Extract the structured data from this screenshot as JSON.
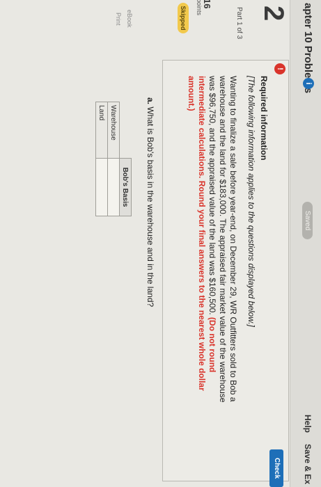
{
  "header": {
    "chapter_title": "apter 10 Problems",
    "info_icon_glyph": "i",
    "saved_label": "Saved",
    "help_label": "Help",
    "save_exit_label": "Save & Ex"
  },
  "sidebar": {
    "question_number": "2",
    "part_label": "Part 1 of 3",
    "points_value": "16",
    "points_label": "points",
    "status_badge": "Skipped",
    "ebook_label": "eBook",
    "print_label": "Print"
  },
  "required_info": {
    "alert_glyph": "!",
    "title": "Required information",
    "note": "[The following information applies to the questions displayed below.]",
    "body": "Wanting to finalize a sale before year-end, on December 29, WR Outfitters sold to Bob a warehouse and the land for $183,000. The appraised fair market value of the warehouse was $96,750, and the appraised value of the land was $160,500. ",
    "instruction": "(Do not round intermediate calculations. Round your final answers to the nearest whole dollar amount.)"
  },
  "check_button_label": "Check",
  "question": {
    "prefix": "a.",
    "text": "What is Bob's basis in the warehouse and in the land?"
  },
  "answer_table": {
    "column_header": "Bob's Basis",
    "rows": [
      {
        "label": "Warehouse",
        "value": ""
      },
      {
        "label": "Land",
        "value": ""
      }
    ]
  },
  "colors": {
    "accent_blue": "#1e6fb8",
    "alert_red": "#d9342b",
    "skipped_yellow": "#f2c94c"
  }
}
